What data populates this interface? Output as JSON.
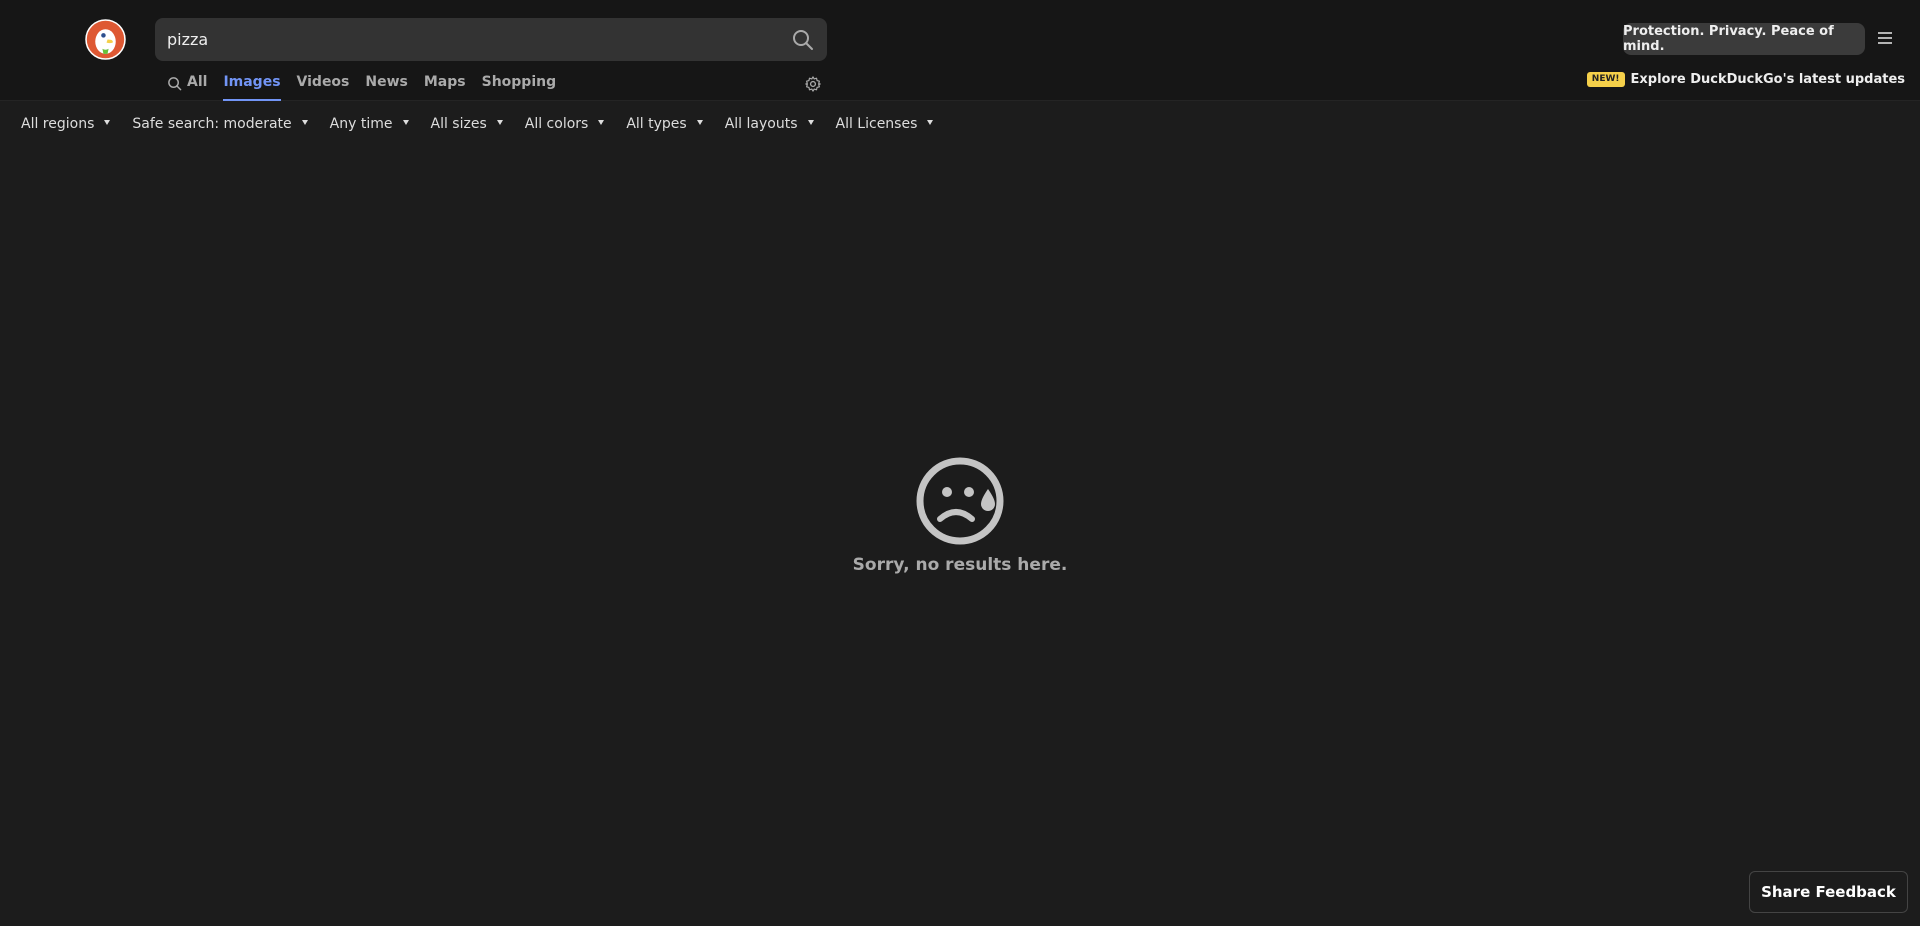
{
  "search": {
    "query": "pizza"
  },
  "tabs": [
    {
      "label": "All",
      "active": false,
      "icon": "search-icon"
    },
    {
      "label": "Images",
      "active": true
    },
    {
      "label": "Videos",
      "active": false
    },
    {
      "label": "News",
      "active": false
    },
    {
      "label": "Maps",
      "active": false
    },
    {
      "label": "Shopping",
      "active": false
    }
  ],
  "header": {
    "promo_label": "Protection. Privacy. Peace of mind.",
    "new_badge": "NEW!",
    "updates_label": "Explore DuckDuckGo's latest updates"
  },
  "filters": [
    "All regions",
    "Safe search: moderate",
    "Any time",
    "All sizes",
    "All colors",
    "All types",
    "All layouts",
    "All Licenses"
  ],
  "empty_state": {
    "message": "Sorry, no results here.",
    "icon": "sad-face-icon"
  },
  "feedback": {
    "label": "Share Feedback"
  },
  "colors": {
    "background": "#1c1c1c",
    "header": "#161616",
    "accent": "#7295f6",
    "logo": "#de5833",
    "badge": "#f5d04a"
  }
}
